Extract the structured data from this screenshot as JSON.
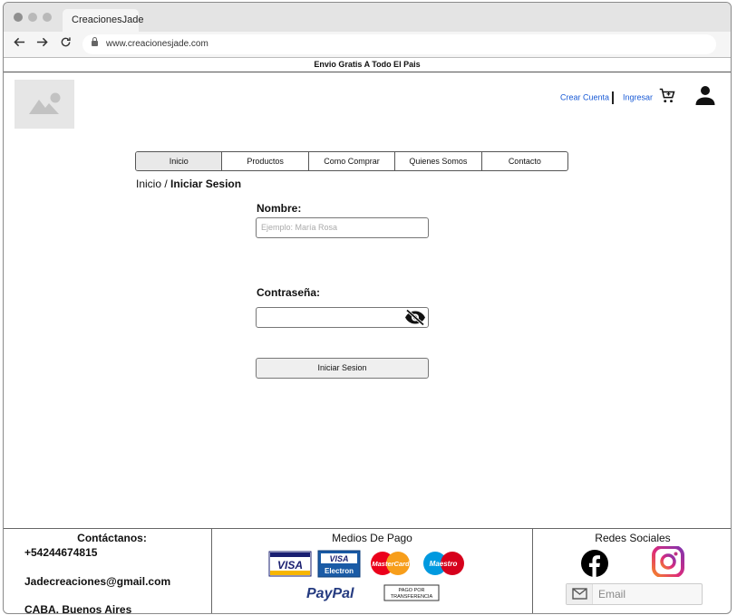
{
  "browser": {
    "tab_title": "CreacionesJade",
    "url": "www.creacionesjade.com"
  },
  "promo": "Envio Gratis A Todo El Pais",
  "header": {
    "create_account": "Crear Cuenta",
    "login": "Ingresar"
  },
  "menu": [
    {
      "label": "Inicio",
      "active": true
    },
    {
      "label": "Productos",
      "active": false
    },
    {
      "label": "Como Comprar",
      "active": false
    },
    {
      "label": "Quienes Somos",
      "active": false
    },
    {
      "label": "Contacto",
      "active": false
    }
  ],
  "breadcrumb": {
    "home": "Inicio",
    "separator": "/",
    "current": "Iniciar Sesion"
  },
  "form": {
    "name_label": "Nombre:",
    "name_placeholder": "Ejemplo: María Rosa",
    "password_label": "Contraseña:",
    "password_value": "",
    "submit_label": "Iniciar Sesion"
  },
  "footer": {
    "contact_title": "Contáctanos:",
    "phone": "+54244674815",
    "email": "Jadecreaciones@gmail.com",
    "location": "CABA, Buenos Aires",
    "payment_title": "Medios De Pago",
    "payments": {
      "visa": "VISA",
      "visa_electron_top": "VISA",
      "visa_electron_bottom": "Electron",
      "mastercard": "MasterCard",
      "maestro": "Maestro",
      "paypal": "PayPal",
      "transfer_line1": "PAGO POR",
      "transfer_line2": "TRANSFERENCIA"
    },
    "social_title": "Redes Sociales",
    "newsletter_placeholder": "Email"
  },
  "colors": {
    "link_blue": "#1a5bd6",
    "instagram": "#c13584",
    "paypal_dark": "#253b80",
    "paypal_light": "#179bd7"
  }
}
